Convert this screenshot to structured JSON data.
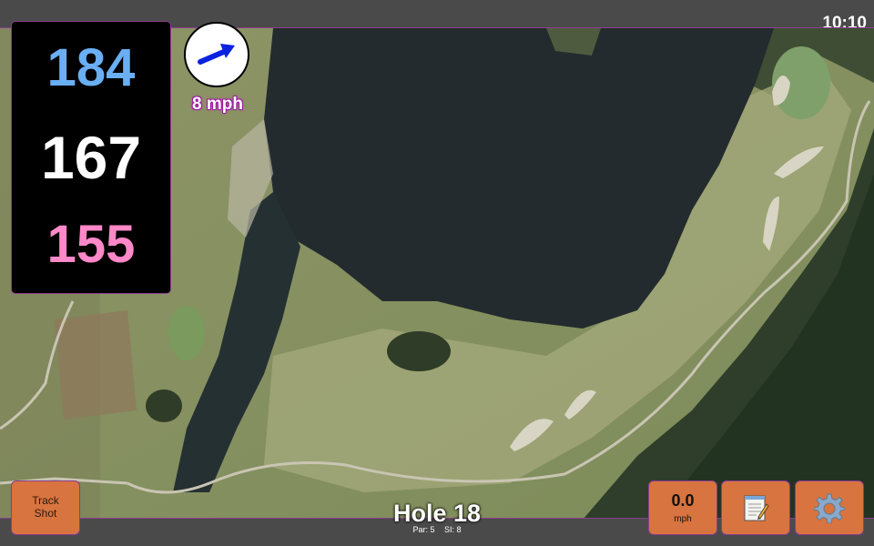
{
  "status_bar": {
    "time": "10:10"
  },
  "distances": {
    "back": "184",
    "middle": "167",
    "front": "155"
  },
  "wind": {
    "speed_label": "8 mph",
    "direction_icon": "wind-arrow-icon"
  },
  "buttons": {
    "track_shot": {
      "line1": "Track",
      "line2": "Shot"
    },
    "speed": {
      "value": "0.0",
      "unit": "mph"
    },
    "notes_icon": "notepad-icon",
    "settings_icon": "gear-icon"
  },
  "hole": {
    "title": "Hole 18",
    "par_label": "Par: 5",
    "si_label": "SI: 8"
  },
  "colors": {
    "back": "#6aaef4",
    "middle": "#ffffff",
    "front": "#ff88c8",
    "button": "#d8743f",
    "accent_border": "#8a3d8f",
    "wind_label_outline": "#a01aa5"
  }
}
